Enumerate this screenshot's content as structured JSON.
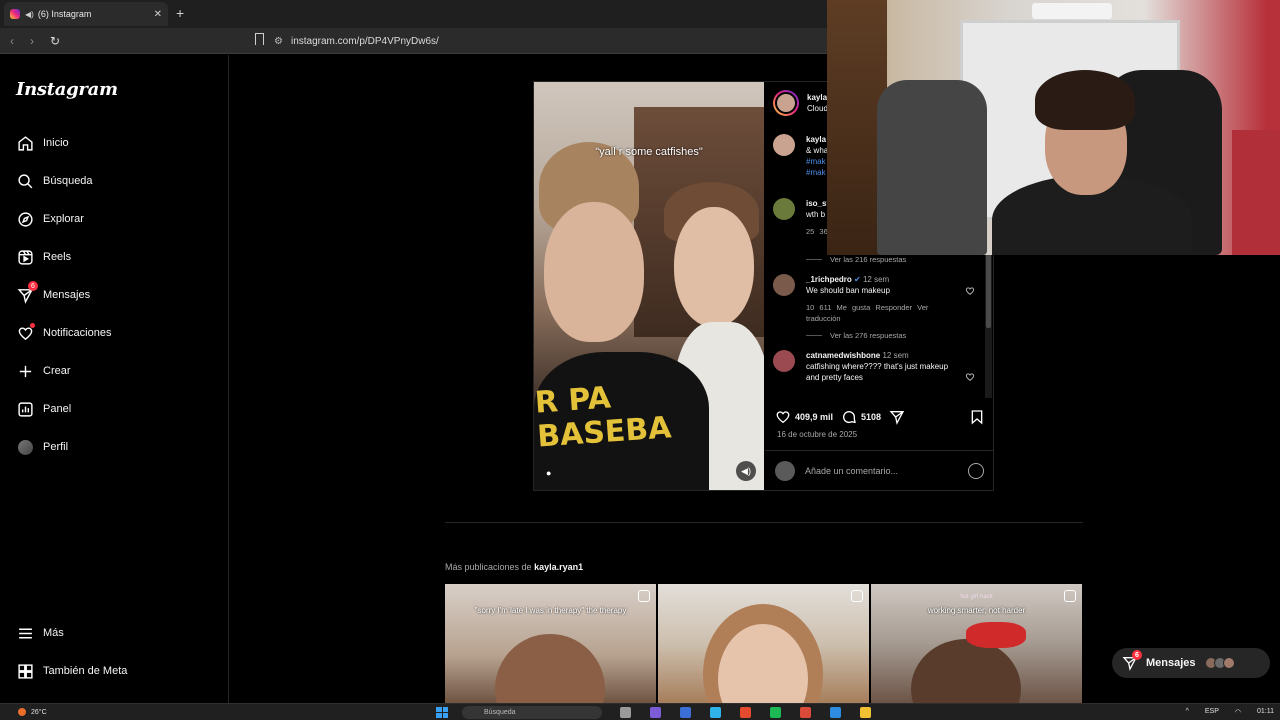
{
  "browser": {
    "tab_title": "(6) Instagram",
    "url": "instagram.com/p/DP4VPnyDw6s/"
  },
  "sidebar": {
    "logo": "Instagram",
    "items": [
      {
        "label": "Inicio",
        "icon": "home-icon"
      },
      {
        "label": "Búsqueda",
        "icon": "search-icon"
      },
      {
        "label": "Explorar",
        "icon": "compass-icon"
      },
      {
        "label": "Reels",
        "icon": "reels-icon"
      },
      {
        "label": "Mensajes",
        "icon": "messenger-icon",
        "badge": "6"
      },
      {
        "label": "Notificaciones",
        "icon": "heart-icon"
      },
      {
        "label": "Crear",
        "icon": "plus-icon"
      },
      {
        "label": "Panel",
        "icon": "dashboard-icon"
      },
      {
        "label": "Perfil",
        "icon": "profile-avatar"
      }
    ],
    "more": "Más",
    "meta": "También de Meta"
  },
  "post": {
    "video_caption": "\"yall r some catfishes\"",
    "author_short": "kayla",
    "author_sub": "Cloud",
    "caption_comment": {
      "user": "kayla",
      "line1": "& wha",
      "tag1": "#mak",
      "tag2": "#mak"
    },
    "comments": [
      {
        "user": "iso_st",
        "text": "wth b",
        "meta": "25 36",
        "replies": "Ver las 216 respuestas"
      },
      {
        "user": "_1richpedro",
        "time": "12 sem",
        "text": "We should ban makeup",
        "meta": "10 611 Me gusta   Responder   Ver traducción",
        "replies": "Ver las 276 respuestas"
      },
      {
        "user": "catnamedwishbone",
        "time": "12 sem",
        "text": "catfishing where???? that's just makeup and pretty faces"
      }
    ],
    "likes": "409,9 mil",
    "comment_count": "5108",
    "date": "16 de octubre de 2025",
    "add_comment_placeholder": "Añade un comentario..."
  },
  "more_posts": {
    "prefix": "Más publicaciones de",
    "user": "kayla.ryan1",
    "thumbs": [
      {
        "small": "",
        "caption": "\"sorry I'm late I was in therapy\" the therapy"
      },
      {
        "small": "",
        "caption": ""
      },
      {
        "small": "hot girl hack",
        "caption": "working smarter, not harder"
      }
    ]
  },
  "messages_pill": {
    "label": "Mensajes",
    "badge": "6"
  },
  "taskbar": {
    "weather": "26°C",
    "search": "Búsqueda",
    "lang": "ESP",
    "time": "01:11"
  },
  "colors": {
    "accent": "#ff3040",
    "link": "#4d8de8",
    "background": "#000000"
  }
}
